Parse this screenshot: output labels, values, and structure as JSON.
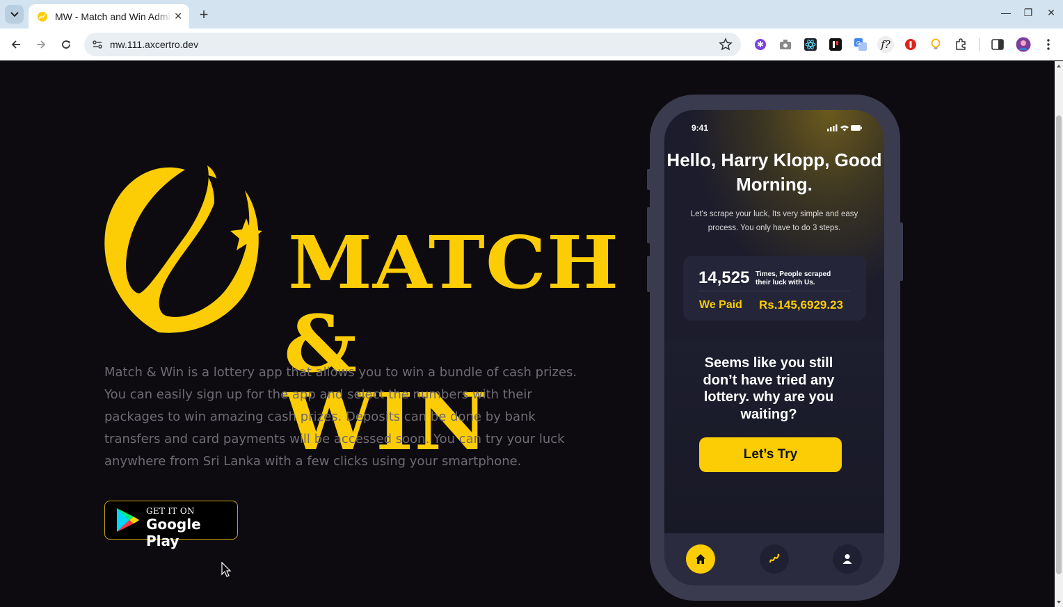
{
  "browser": {
    "tab_title": "MW - Match and Win Admin",
    "url": "mw.111.axcertro.dev"
  },
  "hero": {
    "logo_line1": "MATCH",
    "logo_line2": "& WIN",
    "description": "Match & Win is a lottery app that allows you to win a bundle of cash prizes. You can easily sign up for the app and select the numbers with their packages to win amazing cash prizes. Deposits can be done by bank transfers and card payments will be accessed soon. You can try your luck anywhere from Sri Lanka with a few clicks using your smartphone.",
    "store_badge_top": "GET IT ON",
    "store_badge_bottom": "Google Play"
  },
  "phone": {
    "status_time": "9:41",
    "greeting": "Hello, Harry Klopp, Good Morning.",
    "subtitle": "Let's scrape your luck,  Its very simple and easy process. You only have to do 3 steps.",
    "scrape_count": "14,525",
    "scrape_label": "Times, People scraped their luck with Us.",
    "paid_label": "We Paid",
    "paid_amount": "Rs.145,6929.23",
    "empty_message": "Seems like you still don’t have tried any lottery. why are you waiting?",
    "cta_label": "Let’s Try",
    "nav_icons": [
      "home-icon",
      "logo-icon",
      "profile-icon"
    ]
  },
  "colors": {
    "brand_yellow": "#fccc05",
    "page_bg": "#0d0b10"
  }
}
